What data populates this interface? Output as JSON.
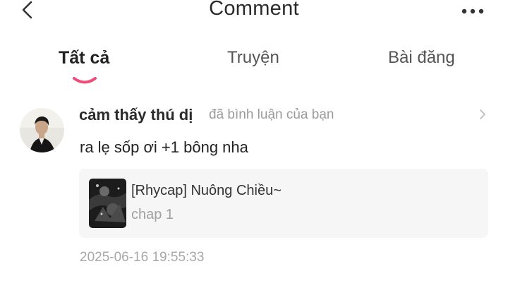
{
  "header": {
    "title": "Comment",
    "back_icon": "chevron-left-icon",
    "more_icon": "more-horizontal-icon"
  },
  "tabs": [
    {
      "label": "Tất cả",
      "active": true
    },
    {
      "label": "Truyện",
      "active": false
    },
    {
      "label": "Bài đăng",
      "active": false
    }
  ],
  "accent_color": "#ee4d7a",
  "notification": {
    "username": "cảm thấy thú dị",
    "action": "đã bình luận của bạn",
    "comment": "ra lẹ sốp ơi +1 bông nha",
    "story": {
      "title": "[Rhycap] Nuông Chiều~",
      "chapter": "chap 1"
    },
    "timestamp": "2025-06-16 19:55:33"
  }
}
